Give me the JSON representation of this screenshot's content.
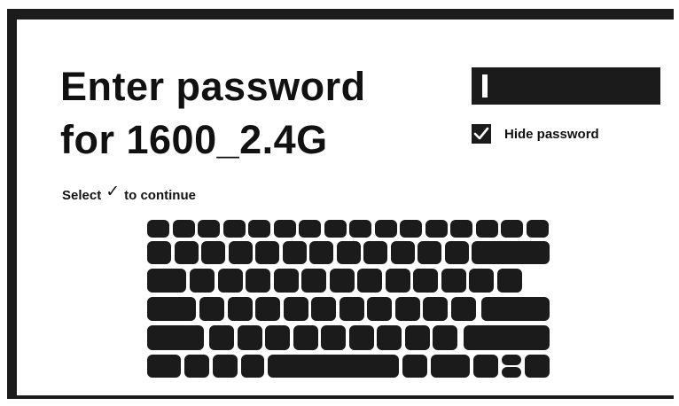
{
  "dialog": {
    "title_line1": "Enter password",
    "title_line2": "for 1600_2.4G",
    "hint_prefix": "Select",
    "hint_icon": "checkmark-icon",
    "hint_suffix": "to continue"
  },
  "password": {
    "value": "",
    "input_color": "#1b1b1b",
    "caret_color": "#ffffff"
  },
  "hide_password": {
    "label": "Hide password",
    "checked": true
  },
  "keyboard": {
    "key_color": "#1b1b1b",
    "icons": [
      "shift-icon",
      "globe-icon",
      "space-bar-icon",
      "arrow-up-icon",
      "arrow-down-icon",
      "arrow-left-icon",
      "arrow-right-icon",
      "enter-icon",
      "backspace-icon"
    ]
  },
  "colors": {
    "background": "#ffffff",
    "frame": "#1b1b1b",
    "text": "#111111"
  }
}
